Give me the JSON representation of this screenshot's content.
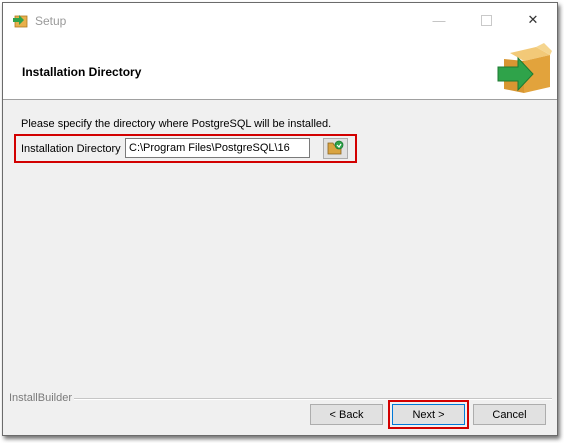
{
  "window": {
    "title": "Setup"
  },
  "header": {
    "title": "Installation Directory"
  },
  "main": {
    "description": "Please specify the directory where PostgreSQL will be installed.",
    "directory_label": "Installation Directory",
    "directory_value": "C:\\Program Files\\PostgreSQL\\16"
  },
  "footer": {
    "brand": "InstallBuilder",
    "back_label": "< Back",
    "next_label": "Next >",
    "cancel_label": "Cancel"
  },
  "colors": {
    "highlight": "#d20000",
    "icon_green": "#2fa34a",
    "box_orange": "#e8b04c",
    "focus_blue": "#0078d7"
  },
  "icons": [
    "setup-app-icon",
    "minimize-icon",
    "maximize-icon",
    "close-icon",
    "package-arrow-icon",
    "folder-browse-icon"
  ]
}
